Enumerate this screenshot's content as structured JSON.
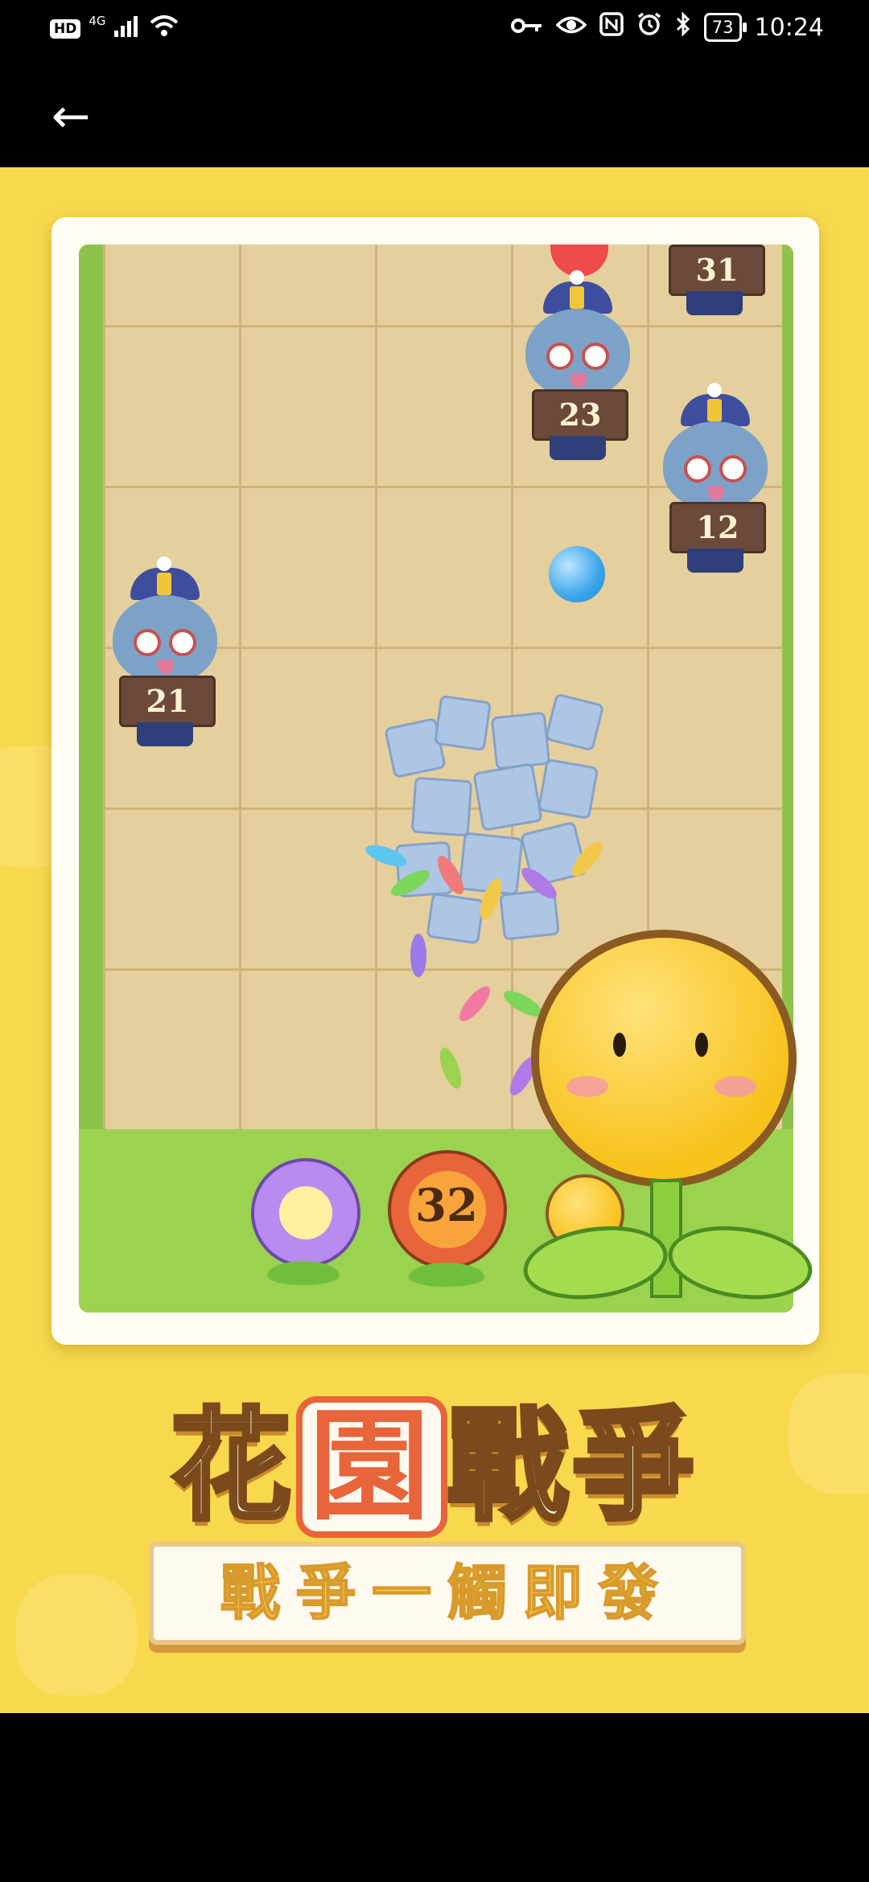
{
  "status_bar": {
    "hd_badge": "HD",
    "network": "4G",
    "time": "10:24",
    "battery": "73"
  },
  "nav": {
    "back_icon": "←"
  },
  "game": {
    "zombies": [
      {
        "label": "31"
      },
      {
        "label": "23"
      },
      {
        "label": "12"
      },
      {
        "label": "21"
      }
    ],
    "flower_level": "32"
  },
  "banner": {
    "title_part1": "花",
    "title_boxed": "園",
    "title_part2": "戰爭",
    "subtitle": "戰爭一觸即發"
  }
}
